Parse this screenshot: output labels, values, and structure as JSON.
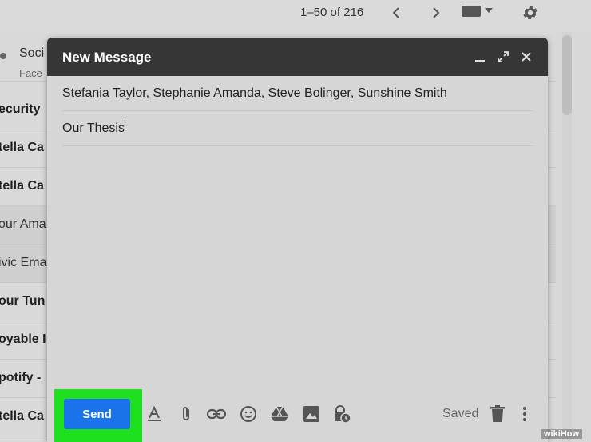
{
  "toolbar": {
    "pager": "1–50 of 216"
  },
  "inbox": {
    "social_title": "Soci",
    "social_sub": "Face",
    "rows": [
      "ecurity",
      "tella Ca",
      "tella Ca",
      "our Ama",
      "ivic Ema",
      "our Tun",
      "oyable I",
      "potify -",
      "tella Ca"
    ]
  },
  "compose": {
    "title": "New Message",
    "to": "Stefania Taylor, Stephanie Amanda, Steve Bolinger, Sunshine Smith",
    "subject": "Our Thesis",
    "send_label": "Send",
    "saved_label": "Saved"
  },
  "watermark": "wikiHow",
  "colors": {
    "send": "#1a73e8",
    "highlight": "#1ee01e",
    "compose_header": "#363636"
  }
}
